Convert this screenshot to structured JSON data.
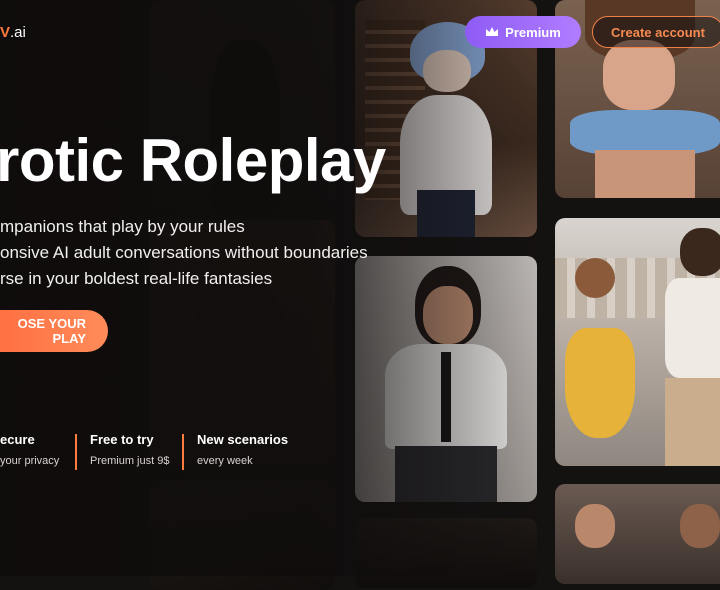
{
  "header": {
    "logo_text": ".ai",
    "logo_accent": "V",
    "premium_label": "Premium",
    "premium_icon": "crown-icon",
    "create_account_label": "Create account"
  },
  "hero": {
    "title": "rotic Roleplay",
    "bullets": [
      "mpanions that play by your rules",
      "onsive AI adult conversations without boundaries",
      "rse in your boldest real-life fantasies"
    ],
    "cta_label": "OSE YOUR PLAY"
  },
  "features": [
    {
      "heading": "ecure",
      "sub": "your privacy"
    },
    {
      "heading": "Free to try",
      "sub": "Premium just 9$"
    },
    {
      "heading": "New scenarios",
      "sub": "every week"
    }
  ],
  "colors": {
    "accent": "#ff7a3d",
    "premium": "#9d6cf7",
    "background": "#141111"
  }
}
